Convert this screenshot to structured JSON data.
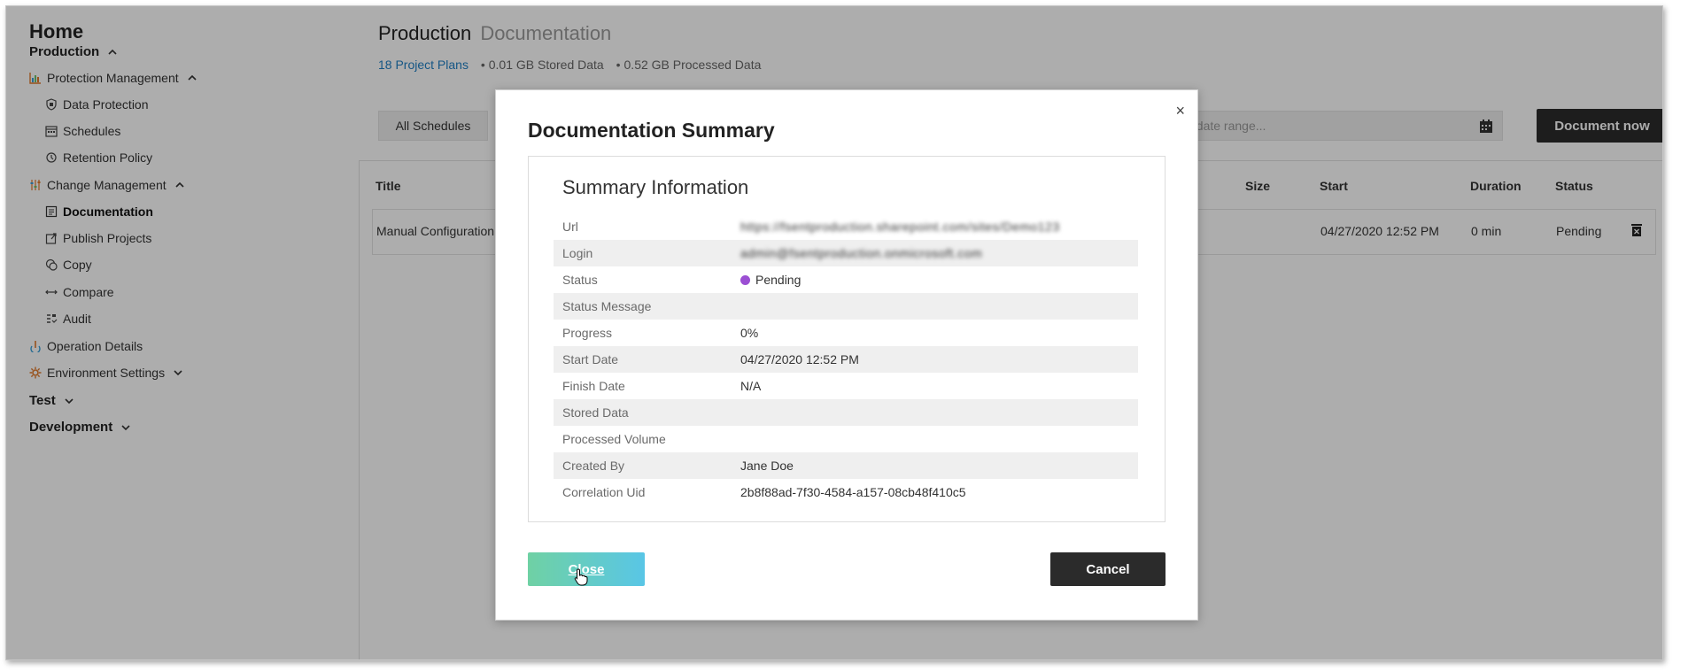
{
  "sidebar": {
    "home": "Home",
    "production": "Production",
    "protection_management": "Protection Management",
    "data_protection": "Data Protection",
    "schedules": "Schedules",
    "retention_policy": "Retention Policy",
    "change_management": "Change Management",
    "documentation": "Documentation",
    "publish_projects": "Publish Projects",
    "copy": "Copy",
    "compare": "Compare",
    "audit": "Audit",
    "operation_details": "Operation Details",
    "environment_settings": "Environment Settings",
    "test": "Test",
    "development": "Development"
  },
  "main": {
    "title_primary": "Production",
    "title_secondary": "Documentation",
    "project_plans": "18 Project Plans",
    "stored_data": "0.01 GB Stored Data",
    "processed_data": "0.52 GB Processed Data",
    "schedules_tab": "All Schedules",
    "date_range_placeholder": "ct date range...",
    "document_now": "Document now"
  },
  "table": {
    "headers": {
      "title": "Title",
      "size": "Size",
      "start": "Start",
      "duration": "Duration",
      "status": "Status"
    },
    "row": {
      "title": "Manual Configuration",
      "start": "04/27/2020 12:52 PM",
      "duration": "0 min",
      "status": "Pending"
    }
  },
  "modal": {
    "title": "Documentation Summary",
    "close_x": "×",
    "summary_heading": "Summary Information",
    "rows": [
      {
        "label": "Url",
        "value": "https://fsentproduction.sharepoint.com/sites/Demo123"
      },
      {
        "label": "Login",
        "value": "admin@fsentproduction.onmicrosoft.com"
      },
      {
        "label": "Status",
        "value": "Pending"
      },
      {
        "label": "Status Message",
        "value": ""
      },
      {
        "label": "Progress",
        "value": "0%"
      },
      {
        "label": "Start Date",
        "value": "04/27/2020 12:52 PM"
      },
      {
        "label": "Finish Date",
        "value": "N/A"
      },
      {
        "label": "Stored Data",
        "value": ""
      },
      {
        "label": "Processed Volume",
        "value": ""
      },
      {
        "label": "Created By",
        "value": "Jane Doe"
      },
      {
        "label": "Correlation Uid",
        "value": "2b8f88ad-7f30-4584-a157-08cb48f410c5"
      }
    ],
    "status_color": "#9b4fd3",
    "close_button": "Close",
    "cancel_button": "Cancel"
  },
  "icons": {
    "accent": "#e07a2b"
  }
}
